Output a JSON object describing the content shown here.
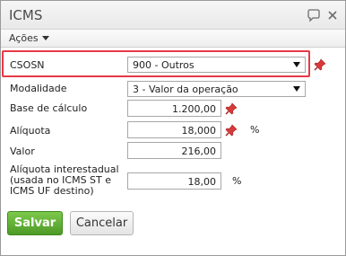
{
  "window": {
    "title": "ICMS"
  },
  "toolbar": {
    "actions_label": "Ações"
  },
  "form": {
    "csosn": {
      "label": "CSOSN",
      "value": "900 - Outros"
    },
    "modalidade": {
      "label": "Modalidade",
      "value": "3 - Valor da operação"
    },
    "base": {
      "label": "Base de cálculo",
      "value": "1.200,00"
    },
    "aliquota": {
      "label": "Alíquota",
      "value": "18,000",
      "unit": "%"
    },
    "valor": {
      "label": "Valor",
      "value": "216,00"
    },
    "aliquota_inter": {
      "label_line1": "Alíquota interestadual",
      "label_line2": "(usada no ICMS ST e",
      "label_line3": "ICMS UF destino)",
      "value": "18,00",
      "unit": "%"
    }
  },
  "buttons": {
    "save": "Salvar",
    "cancel": "Cancelar"
  },
  "colors": {
    "highlight": "#e63a45",
    "save_button": "#5aa832",
    "pin": "#d83a3a"
  },
  "icons": {
    "comment": "comment-icon",
    "close": "close-icon",
    "pin": "pin-icon"
  }
}
